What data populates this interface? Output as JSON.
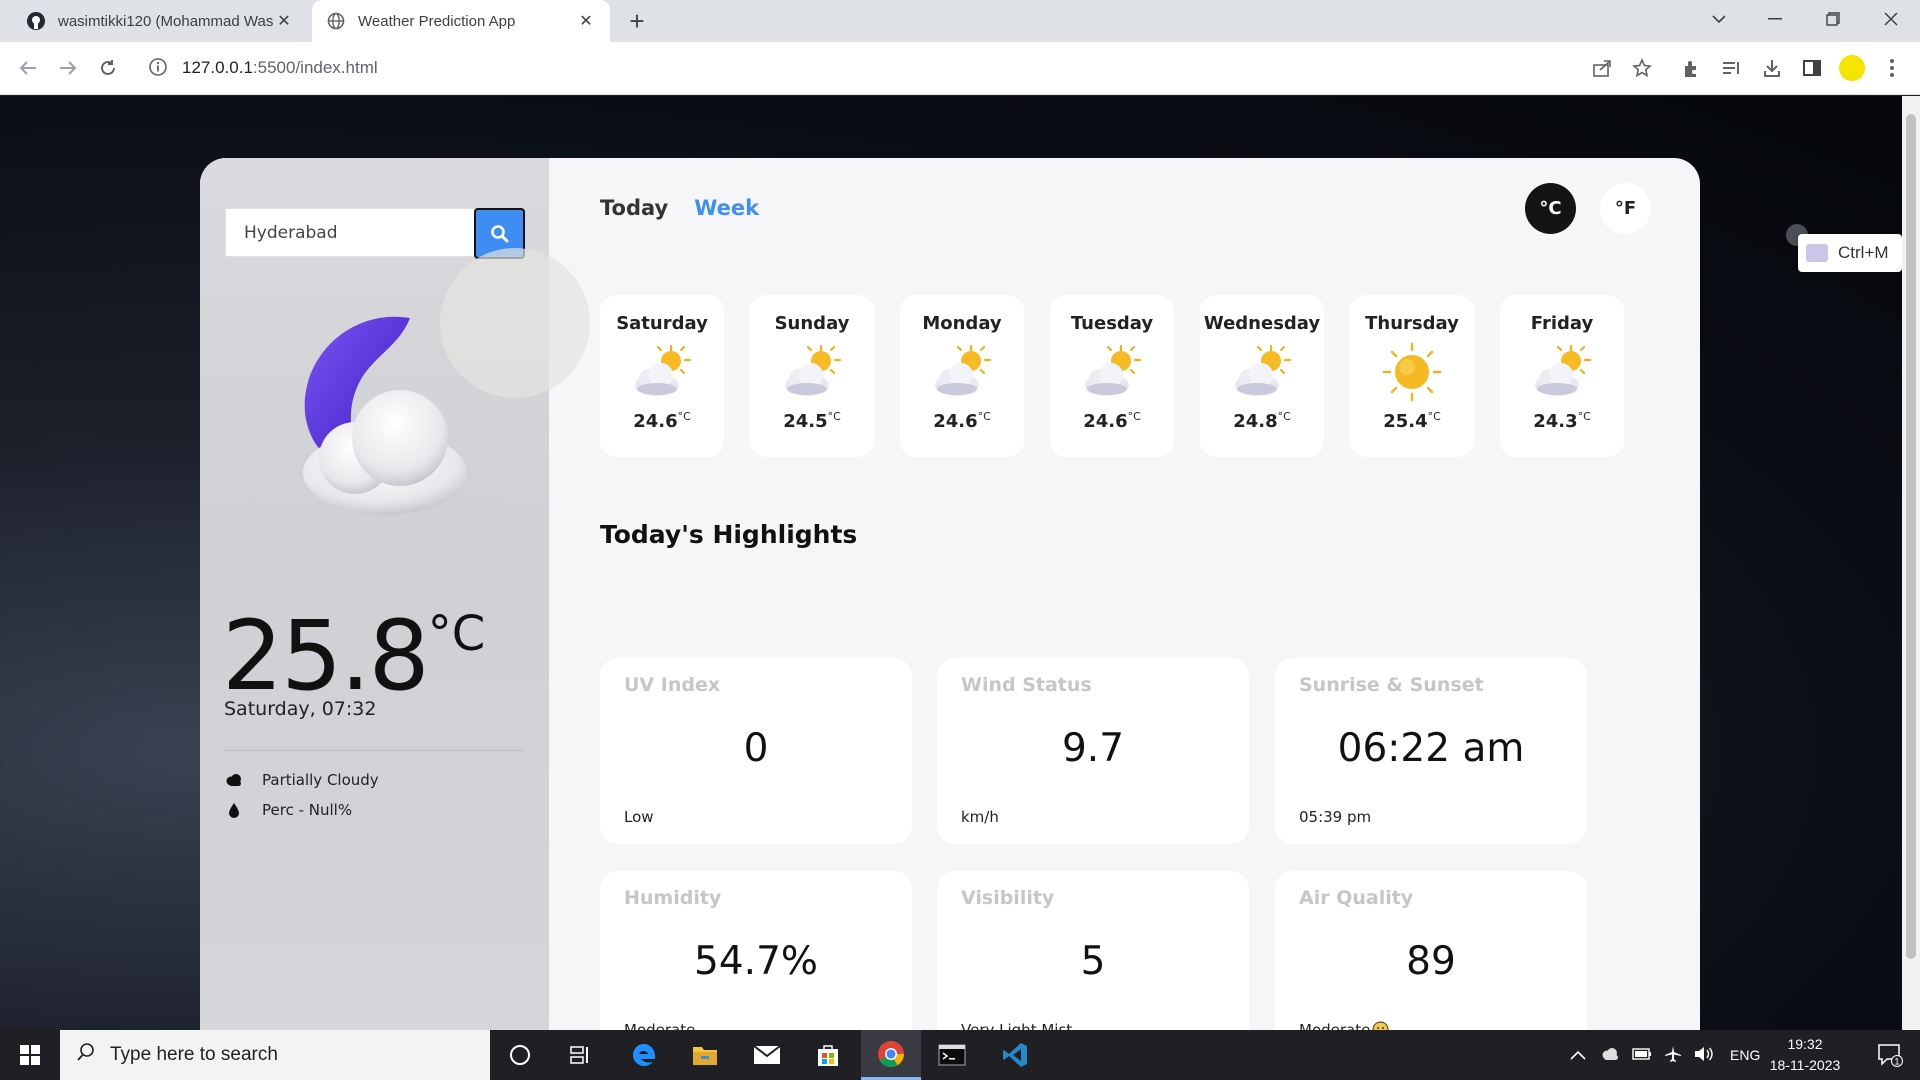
{
  "browser": {
    "tabs": [
      {
        "title": "wasimtikki120 (Mohammad Was",
        "close": "✕"
      },
      {
        "title": "Weather Prediction App",
        "close": "✕"
      }
    ],
    "new_tab": "+",
    "url_host": "127.0.0.1",
    "url_path": ":5500/index.html",
    "extension_popup": "Ctrl+M"
  },
  "sidebar": {
    "search_value": "Hyderabad",
    "temperature": "25.8",
    "temperature_unit": "°C",
    "datetime": "Saturday, 07:32",
    "condition": "Partially Cloudy",
    "precipitation": "Perc - Null%"
  },
  "header": {
    "tab_today": "Today",
    "tab_week": "Week",
    "unit_celsius": "°C",
    "unit_fahrenheit": "°F"
  },
  "week": [
    {
      "day": "Saturday",
      "temp": "24.6",
      "unit": "°C",
      "icon": "partly-sunny-icon"
    },
    {
      "day": "Sunday",
      "temp": "24.5",
      "unit": "°C",
      "icon": "partly-sunny-icon"
    },
    {
      "day": "Monday",
      "temp": "24.6",
      "unit": "°C",
      "icon": "partly-sunny-icon"
    },
    {
      "day": "Tuesday",
      "temp": "24.6",
      "unit": "°C",
      "icon": "partly-sunny-icon"
    },
    {
      "day": "Wednesday",
      "temp": "24.8",
      "unit": "°C",
      "icon": "partly-sunny-icon"
    },
    {
      "day": "Thursday",
      "temp": "25.4",
      "unit": "°C",
      "icon": "sunny-icon"
    },
    {
      "day": "Friday",
      "temp": "24.3",
      "unit": "°C",
      "icon": "partly-sunny-icon"
    }
  ],
  "highlights": {
    "title": "Today's Highlights",
    "uv": {
      "label": "UV Index",
      "value": "0",
      "status": "Low"
    },
    "wind": {
      "label": "Wind Status",
      "value": "9.7",
      "status": "km/h"
    },
    "sun": {
      "label": "Sunrise & Sunset",
      "value": "06:22 am",
      "status": "05:39 pm"
    },
    "humidity": {
      "label": "Humidity",
      "value": "54.7%",
      "status": "Moderate"
    },
    "visibility": {
      "label": "Visibility",
      "value": "5",
      "status": "Very Light Mist"
    },
    "air": {
      "label": "Air Quality",
      "value": "89",
      "status": "Moderate"
    }
  },
  "taskbar": {
    "search_placeholder": "Type here to search",
    "language": "ENG",
    "time": "19:32",
    "date": "18-11-2023",
    "notifications": "1"
  },
  "colors": {
    "accent": "#3f8cf3",
    "week_tab": "#3d8ff0",
    "card_bg": "#f6f6f8",
    "moon": "#6a3de8"
  }
}
